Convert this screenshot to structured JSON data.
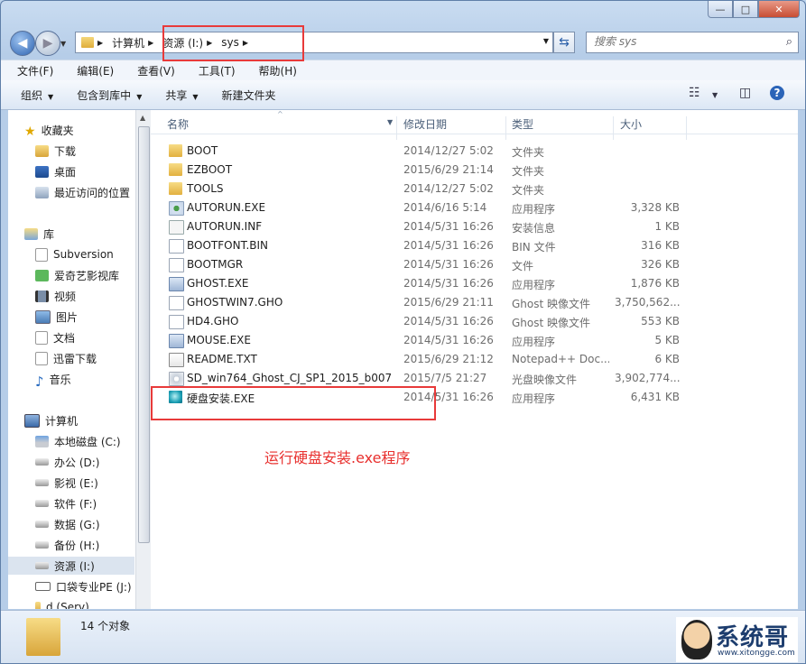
{
  "window": {
    "caption_buttons": [
      "—",
      "□",
      "✕"
    ]
  },
  "address": {
    "path": [
      "计算机",
      "资源 (I:)",
      "sys"
    ]
  },
  "search": {
    "placeholder": "搜索 sys"
  },
  "menu": [
    "文件(F)",
    "编辑(E)",
    "查看(V)",
    "工具(T)",
    "帮助(H)"
  ],
  "toolbar": {
    "organize": "组织",
    "include_library": "包含到库中",
    "share": "共享",
    "new_folder": "新建文件夹"
  },
  "nav": {
    "favorites": "收藏夹",
    "fav_items": [
      "下载",
      "桌面",
      "最近访问的位置"
    ],
    "libraries": "库",
    "lib_items": [
      "Subversion",
      "爱奇艺影视库",
      "视频",
      "图片",
      "文档",
      "迅雷下载",
      "音乐"
    ],
    "computer": "计算机",
    "drives": [
      "本地磁盘 (C:)",
      "办公 (D:)",
      "影视 (E:)",
      "软件 (F:)",
      "数据 (G:)",
      "备份 (H:)",
      "资源 (I:)",
      "口袋专业PE (J:)",
      "d (Serv)"
    ]
  },
  "columns": {
    "name": "名称",
    "date": "修改日期",
    "type": "类型",
    "size": "大小"
  },
  "files": [
    {
      "name": "BOOT",
      "date": "2014/12/27 5:02",
      "type": "文件夹",
      "size": "",
      "icon": "folder-icon"
    },
    {
      "name": "EZBOOT",
      "date": "2015/6/29 21:14",
      "type": "文件夹",
      "size": "",
      "icon": "folder-icon"
    },
    {
      "name": "TOOLS",
      "date": "2014/12/27 5:02",
      "type": "文件夹",
      "size": "",
      "icon": "folder-icon"
    },
    {
      "name": "AUTORUN.EXE",
      "date": "2014/6/16 5:14",
      "type": "应用程序",
      "size": "3,328 KB",
      "icon": "exe-icon"
    },
    {
      "name": "AUTORUN.INF",
      "date": "2014/5/31 16:26",
      "type": "安装信息",
      "size": "1 KB",
      "icon": "inf-icon"
    },
    {
      "name": "BOOTFONT.BIN",
      "date": "2014/5/31 16:26",
      "type": "BIN 文件",
      "size": "316 KB",
      "icon": "file-icon"
    },
    {
      "name": "BOOTMGR",
      "date": "2014/5/31 16:26",
      "type": "文件",
      "size": "326 KB",
      "icon": "file-icon"
    },
    {
      "name": "GHOST.EXE",
      "date": "2014/5/31 16:26",
      "type": "应用程序",
      "size": "1,876 KB",
      "icon": "app-icon"
    },
    {
      "name": "GHOSTWIN7.GHO",
      "date": "2015/6/29 21:11",
      "type": "Ghost 映像文件",
      "size": "3,750,562...",
      "icon": "gho-icon"
    },
    {
      "name": "HD4.GHO",
      "date": "2014/5/31 16:26",
      "type": "Ghost 映像文件",
      "size": "553 KB",
      "icon": "gho-icon"
    },
    {
      "name": "MOUSE.EXE",
      "date": "2014/5/31 16:26",
      "type": "应用程序",
      "size": "5 KB",
      "icon": "app-icon"
    },
    {
      "name": "README.TXT",
      "date": "2015/6/29 21:12",
      "type": "Notepad++ Doc...",
      "size": "6 KB",
      "icon": "txt-icon"
    },
    {
      "name": "SD_win764_Ghost_CJ_SP1_2015_b007",
      "date": "2015/7/5 21:27",
      "type": "光盘映像文件",
      "size": "3,902,774...",
      "icon": "iso-icon"
    },
    {
      "name": "硬盘安装.EXE",
      "date": "2014/5/31 16:26",
      "type": "应用程序",
      "size": "6,431 KB",
      "icon": "disk-installer-icon"
    }
  ],
  "annotation": "运行硬盘安装.exe程序",
  "status": {
    "count": "14 个对象"
  },
  "watermark": {
    "name": "系统哥",
    "url": "www.xitongge.com"
  }
}
